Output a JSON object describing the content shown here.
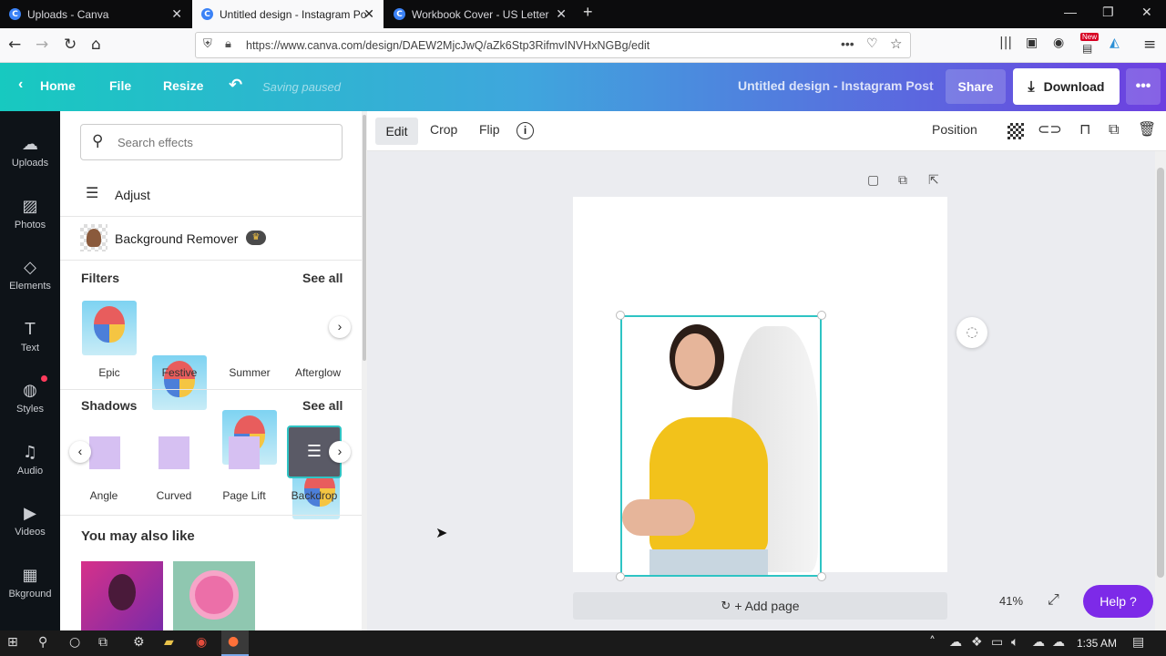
{
  "browser": {
    "tabs": [
      {
        "title": "Uploads - Canva",
        "active": false
      },
      {
        "title": "Untitled design - Instagram Po",
        "active": true
      },
      {
        "title": "Workbook Cover - US Letter",
        "active": false
      }
    ],
    "favicon_letter": "C",
    "url": "https://www.canva.com/design/DAEW2MjcJwQ/aZk6Stp3RifmvINVHxNGBg/edit",
    "new_badge": "New"
  },
  "header": {
    "home": "Home",
    "file": "File",
    "resize": "Resize",
    "saving": "Saving paused",
    "design_title": "Untitled design - Instagram Post",
    "share": "Share",
    "download": "Download"
  },
  "rail": [
    {
      "label": "Uploads",
      "icon": "upload-icon"
    },
    {
      "label": "Photos",
      "icon": "photo-icon"
    },
    {
      "label": "Elements",
      "icon": "elements-icon"
    },
    {
      "label": "Text",
      "icon": "text-icon"
    },
    {
      "label": "Styles",
      "icon": "styles-icon"
    },
    {
      "label": "Audio",
      "icon": "audio-icon"
    },
    {
      "label": "Videos",
      "icon": "video-icon"
    },
    {
      "label": "Bkground",
      "icon": "background-icon"
    }
  ],
  "panel": {
    "search_placeholder": "Search effects",
    "adjust": "Adjust",
    "bg_remover": "Background Remover",
    "filters_title": "Filters",
    "see_all": "See all",
    "filters": [
      "Epic",
      "Festive",
      "Summer",
      "Afterglow"
    ],
    "shadows_title": "Shadows",
    "shadows": [
      "Angle",
      "Curved",
      "Page Lift",
      "Backdrop"
    ],
    "also_like": "You may also like"
  },
  "toolbar": {
    "edit": "Edit",
    "crop": "Crop",
    "flip": "Flip",
    "position": "Position"
  },
  "canvas": {
    "add_page": "+ Add page",
    "zoom": "41%",
    "help": "Help ?"
  },
  "taskbar": {
    "time": "1:35 AM"
  },
  "colors": {
    "accent": "#7d2ae8",
    "selection": "#2ec4c4"
  }
}
